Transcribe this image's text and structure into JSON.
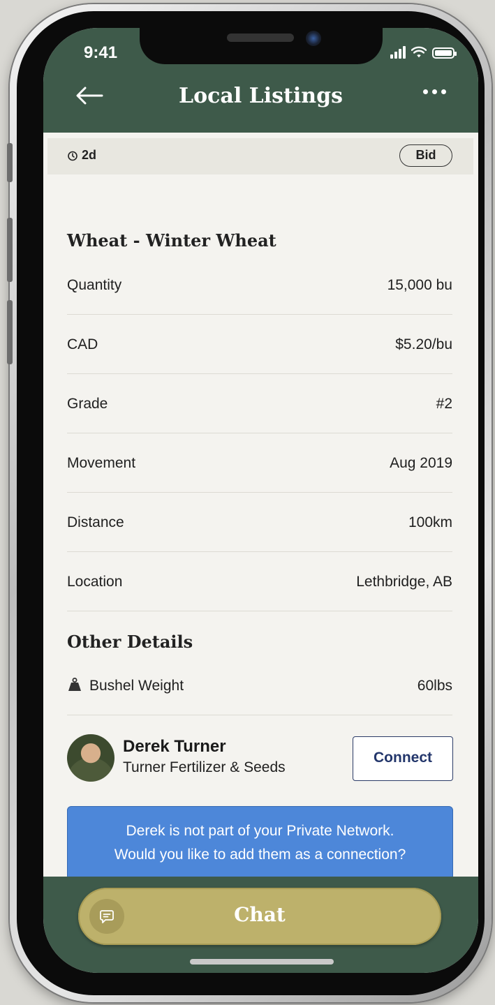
{
  "status_bar": {
    "time": "9:41"
  },
  "header": {
    "title": "Local Listings"
  },
  "listing": {
    "timer": "2d",
    "type_badge": "Bid",
    "title": "Wheat - Winter Wheat",
    "rows": [
      {
        "label": "Quantity",
        "value": "15,000 bu"
      },
      {
        "label": "CAD",
        "value": "$5.20/bu"
      },
      {
        "label": "Grade",
        "value": "#2"
      },
      {
        "label": "Movement",
        "value": "Aug 2019"
      },
      {
        "label": "Distance",
        "value": "100km"
      },
      {
        "label": "Location",
        "value": "Lethbridge, AB"
      }
    ],
    "other_details_title": "Other Details",
    "other_details": [
      {
        "label": "Bushel Weight",
        "value": "60lbs",
        "icon": "weight-icon"
      }
    ]
  },
  "seller": {
    "name": "Derek Turner",
    "company": "Turner Fertilizer & Seeds",
    "connect_label": "Connect"
  },
  "network_banner": {
    "line1": "Derek is not part of your Private Network.",
    "line2": "Would you like to add them as a connection?"
  },
  "bottom": {
    "chat_label": "Chat"
  },
  "colors": {
    "header_green": "#3e5a4a",
    "chat_button": "#bdb16b",
    "banner_blue": "#4d87d9",
    "connect_text": "#23366b"
  }
}
